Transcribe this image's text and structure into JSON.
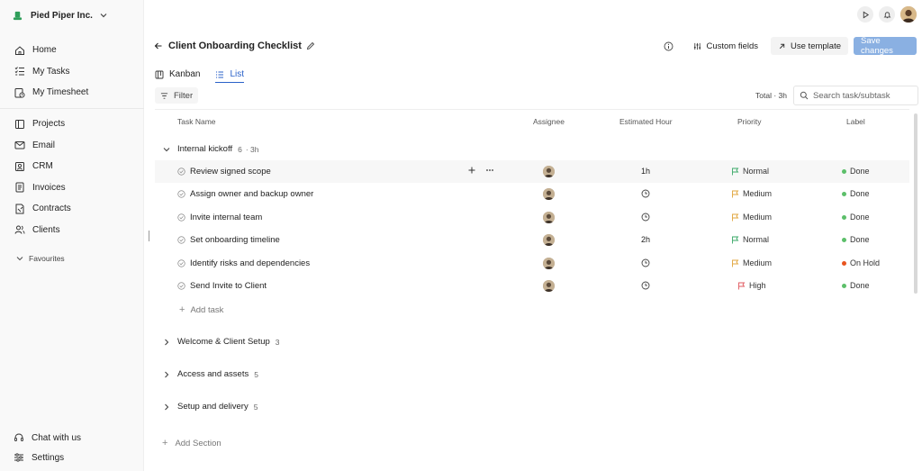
{
  "colors": {
    "accent": "#2a61c9",
    "save_button_bg": "#8ab0e2",
    "done_dot": "#5cbf6a",
    "on_hold_dot": "#e8541f",
    "flag_normal": "#3aa867",
    "flag_medium": "#e0a43b",
    "flag_high": "#e0585f",
    "brand_logo": "#2f9e5a"
  },
  "sidebar": {
    "brand": "Pied Piper Inc.",
    "primary_items": [
      {
        "label": "Home",
        "icon": "home-icon"
      },
      {
        "label": "My Tasks",
        "icon": "tasks-icon"
      },
      {
        "label": "My Timesheet",
        "icon": "timesheet-icon"
      }
    ],
    "secondary_items": [
      {
        "label": "Projects",
        "icon": "projects-icon"
      },
      {
        "label": "Email",
        "icon": "mail-icon"
      },
      {
        "label": "CRM",
        "icon": "crm-icon"
      },
      {
        "label": "Invoices",
        "icon": "invoice-icon"
      },
      {
        "label": "Contracts",
        "icon": "contract-icon"
      },
      {
        "label": "Clients",
        "icon": "clients-icon"
      }
    ],
    "favourites": "Favourites",
    "bottom_items": [
      {
        "label": "Chat with us",
        "icon": "headset-icon"
      },
      {
        "label": "Settings",
        "icon": "settings-icon"
      }
    ]
  },
  "header": {
    "title": "Client Onboarding Checklist",
    "custom_fields": "Custom fields",
    "use_template": "Use template",
    "save_changes": "Save changes"
  },
  "tabs": [
    {
      "label": "Kanban",
      "icon": "kanban-icon",
      "active": false
    },
    {
      "label": "List",
      "icon": "list-icon",
      "active": true
    }
  ],
  "toolbar": {
    "filter": "Filter",
    "total": "Total · 3h",
    "search_placeholder": "Search task/subtask"
  },
  "table": {
    "columns": [
      "Task Name",
      "Assignee",
      "Estimated Hour",
      "Priority",
      "Label"
    ],
    "expanded_group": {
      "name": "Internal kickoff",
      "count": "6",
      "hours": "· 3h"
    },
    "rows": [
      {
        "name": "Review signed scope",
        "estimate": "1h",
        "priority": "Normal",
        "label": "Done"
      },
      {
        "name": "Assign owner and backup owner",
        "estimate": "",
        "priority": "Medium",
        "label": "Done"
      },
      {
        "name": "Invite internal team",
        "estimate": "",
        "priority": "Medium",
        "label": "Done"
      },
      {
        "name": "Set onboarding timeline",
        "estimate": "2h",
        "priority": "Normal",
        "label": "Done"
      },
      {
        "name": "Identify risks and dependencies",
        "estimate": "",
        "priority": "Medium",
        "label": "On Hold"
      },
      {
        "name": "Send Invite to Client",
        "estimate": "",
        "priority": "High",
        "label": "Done"
      }
    ],
    "add_task": "Add task",
    "collapsed_groups": [
      {
        "name": "Welcome & Client Setup",
        "count": "3"
      },
      {
        "name": "Access and assets",
        "count": "5"
      },
      {
        "name": "Setup and delivery",
        "count": "5"
      }
    ],
    "add_section": "Add Section"
  }
}
